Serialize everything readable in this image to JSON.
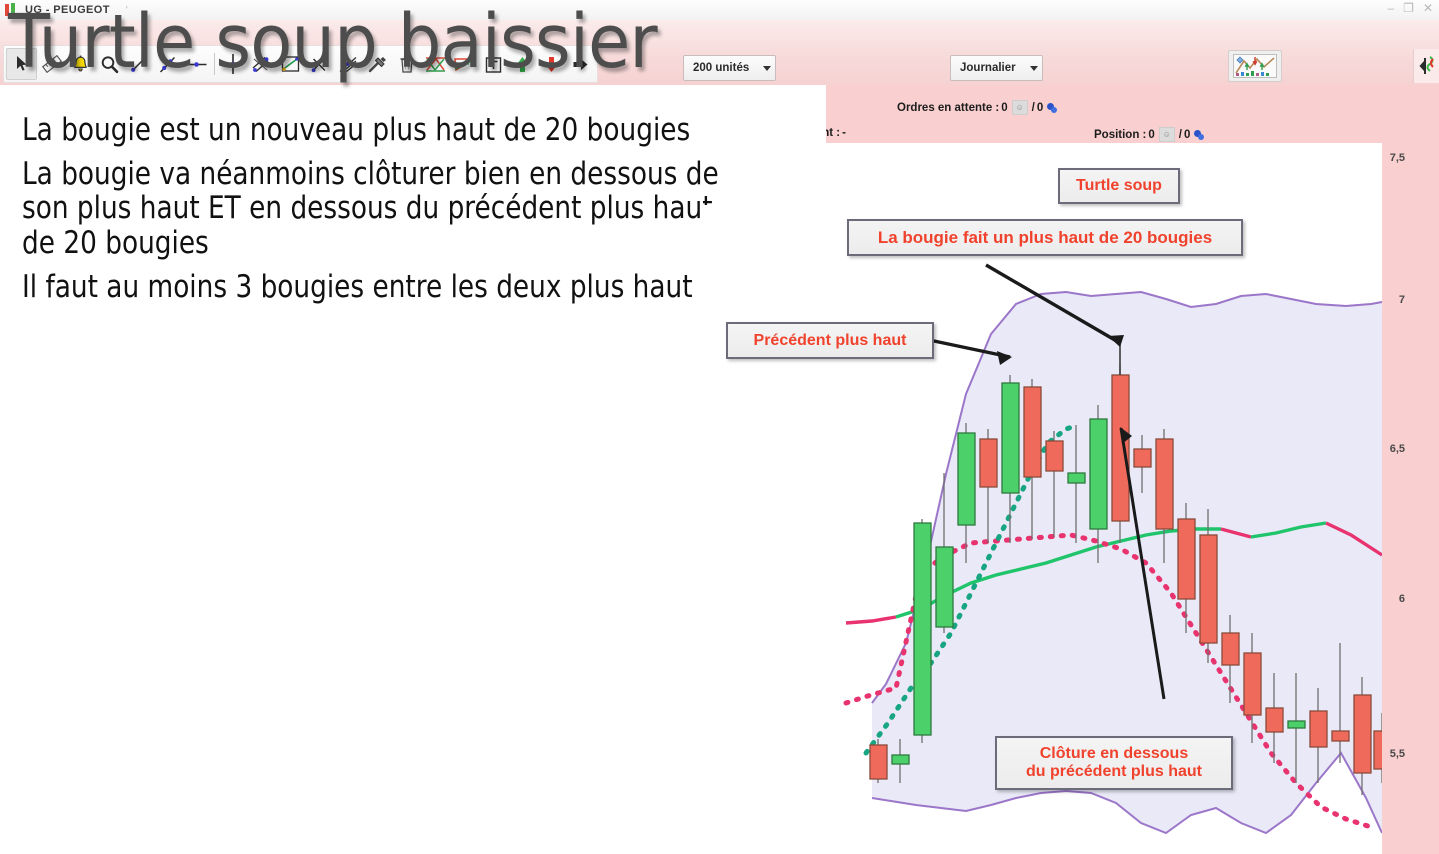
{
  "window": {
    "title": "UG - PEUGEOT",
    "tail_text": "'",
    "icon": "candlestick-icon",
    "controls": {
      "minimize": "–",
      "restore": "❐",
      "close": "✕"
    }
  },
  "toolbar": {
    "tools": [
      {
        "name": "cursor-tool",
        "label": "Curseur",
        "selected": true
      },
      {
        "name": "ruler-tool",
        "label": "Règle"
      },
      {
        "name": "alert-bell-tool",
        "label": "Alerte"
      },
      {
        "name": "zoom-tool",
        "label": "Zoom"
      },
      {
        "name": "short-line-tool",
        "label": "Segment court"
      },
      {
        "name": "line-tool",
        "label": "Droite"
      },
      {
        "name": "horizontal-line-tool",
        "label": "Ligne horizontale"
      },
      {
        "name": "vertical-line-tool",
        "label": "Ligne verticale"
      },
      {
        "name": "parallel-lines-tool",
        "label": "Lignes parallèles"
      },
      {
        "name": "channel-tool",
        "label": "Canal"
      },
      {
        "name": "cross-lines-tool",
        "label": "Croix"
      },
      {
        "name": "fan-lines-tool",
        "label": "Éventail"
      },
      {
        "name": "tools-hammer-tool",
        "label": "Outils"
      },
      {
        "name": "trash-tool",
        "label": "Supprimer"
      },
      {
        "name": "zigzag-indicator-tool",
        "label": "Zigzag"
      },
      {
        "name": "pattern-tool",
        "label": "Figure"
      },
      {
        "name": "text-tool",
        "label": "Texte"
      },
      {
        "name": "arrow-up-tool",
        "label": "Flèche haut"
      },
      {
        "name": "arrow-down-tool",
        "label": "Flèche bas"
      },
      {
        "name": "arrow-right-tool",
        "label": "Flèche droite"
      }
    ],
    "units_dropdown": {
      "value": "200 unités"
    },
    "timeframe_dropdown": {
      "value": "Journalier"
    },
    "analysis_button": {
      "name": "chart-analysis-button"
    },
    "panel_button": {
      "name": "side-panel-button"
    }
  },
  "info_bar": {
    "ordres_label": "Ordres en attente :",
    "ordres_pending": "0",
    "ordres_separator": "/",
    "ordres_open": "0",
    "montant_label": "ntant :",
    "montant_value": "-",
    "position_label": "Position :",
    "position_a": "0",
    "position_separator": "/",
    "position_b": "0"
  },
  "slide": {
    "title": "Turtle soup baissier",
    "bullets": [
      "La bougie est un nouveau plus haut de 20 bougies",
      "La bougie va néanmoins clôturer bien en dessous de son plus haut ET en dessous du précédent plus haut de 20 bougies",
      "Il faut au moins 3 bougies entre les deux plus haut"
    ]
  },
  "callouts": {
    "turtle_soup": "Turtle soup",
    "plus_haut": "La bougie fait un plus haut de 20 bougies",
    "precedent": "Précédent plus haut",
    "cloture": "Clôture en dessous\n du précédent plus haut"
  },
  "colors": {
    "toolbar_pink": "#f7d9d9",
    "info_pink": "#f9cfcf",
    "chart_bg": "#e9e9f7",
    "bollinger": "#9b76c9",
    "candle_up": "#4cd06a",
    "candle_up_border": "#2c7a3f",
    "candle_down": "#ef6a5a",
    "candle_down_border": "#8a4a3a",
    "ma_green": "#1fc46b",
    "ma_pink": "#e8336f",
    "ma_teal": "#17a582",
    "callout_text": "#f0422c",
    "callout_border": "#6b6b7a"
  },
  "chart_data": {
    "type": "candlestick",
    "title": "UG - PEUGEOT",
    "timeframe": "Journalier",
    "units": "200 unités",
    "ylabel": "",
    "xlabel": "",
    "ylim": [
      5.3,
      7.7
    ],
    "y_ticks": [
      "7,5",
      "7",
      "6,5",
      "6",
      "5,5"
    ],
    "y_tick_values": [
      7.5,
      7.0,
      6.5,
      6.0,
      5.5
    ],
    "grid": false,
    "candles": [
      {
        "i": 0,
        "open": 5.62,
        "high": 5.7,
        "low": 5.5,
        "close": 5.52,
        "dir": "down"
      },
      {
        "i": 1,
        "open": 5.57,
        "high": 5.66,
        "low": 5.5,
        "close": 5.58,
        "dir": "up"
      },
      {
        "i": 2,
        "open": 5.6,
        "high": 6.42,
        "low": 5.57,
        "close": 6.4,
        "dir": "up"
      },
      {
        "i": 3,
        "open": 6.1,
        "high": 6.58,
        "low": 6.05,
        "close": 6.38,
        "dir": "up"
      },
      {
        "i": 4,
        "open": 6.2,
        "high": 6.78,
        "low": 6.15,
        "close": 6.7,
        "dir": "up"
      },
      {
        "i": 5,
        "open": 6.62,
        "high": 6.72,
        "low": 6.4,
        "close": 6.56,
        "dir": "down"
      },
      {
        "i": 6,
        "open": 6.45,
        "high": 6.9,
        "low": 6.4,
        "close": 6.86,
        "dir": "up"
      },
      {
        "i": 7,
        "open": 6.82,
        "high": 6.88,
        "low": 6.46,
        "close": 6.55,
        "dir": "down"
      },
      {
        "i": 8,
        "open": 6.58,
        "high": 6.66,
        "low": 6.38,
        "close": 6.52,
        "dir": "down"
      },
      {
        "i": 9,
        "open": 6.52,
        "high": 6.62,
        "low": 6.32,
        "close": 6.55,
        "dir": "up"
      },
      {
        "i": 10,
        "open": 6.46,
        "high": 6.84,
        "low": 6.34,
        "close": 6.8,
        "dir": "up"
      },
      {
        "i": 11,
        "open": 6.92,
        "high": 6.98,
        "low": 6.52,
        "close": 6.58,
        "dir": "down"
      },
      {
        "i": 12,
        "open": 6.66,
        "high": 6.72,
        "low": 6.56,
        "close": 6.62,
        "dir": "down"
      },
      {
        "i": 13,
        "open": 6.68,
        "high": 6.74,
        "low": 6.3,
        "close": 6.36,
        "dir": "down"
      },
      {
        "i": 14,
        "open": 6.34,
        "high": 6.4,
        "low": 6.18,
        "close": 6.22,
        "dir": "down"
      },
      {
        "i": 15,
        "open": 6.28,
        "high": 6.36,
        "low": 5.92,
        "close": 5.98,
        "dir": "down"
      },
      {
        "i": 16,
        "open": 6.02,
        "high": 6.06,
        "low": 5.86,
        "close": 5.94,
        "dir": "down"
      },
      {
        "i": 17,
        "open": 5.96,
        "high": 6.02,
        "low": 5.7,
        "close": 5.78,
        "dir": "down"
      },
      {
        "i": 18,
        "open": 5.82,
        "high": 5.86,
        "low": 5.66,
        "close": 5.8,
        "dir": "down"
      },
      {
        "i": 19,
        "open": 5.84,
        "high": 5.88,
        "low": 5.6,
        "close": 5.72,
        "dir": "down"
      },
      {
        "i": 20,
        "open": 5.76,
        "high": 6.02,
        "low": 5.62,
        "close": 5.74,
        "dir": "down"
      },
      {
        "i": 21,
        "open": 5.8,
        "high": 5.86,
        "low": 5.56,
        "close": 5.62,
        "dir": "down"
      },
      {
        "i": 22,
        "open": 5.66,
        "high": 5.7,
        "low": 5.52,
        "close": 5.58,
        "dir": "down"
      }
    ],
    "series": [
      {
        "name": "Bollinger supérieure",
        "style": "solid",
        "color": "#9b76c9"
      },
      {
        "name": "Bollinger inférieure",
        "style": "solid",
        "color": "#9b76c9"
      },
      {
        "name": "Moyenne mobile",
        "style": "solid",
        "color": "#1fc46b"
      },
      {
        "name": "Indicateur rose",
        "style": "dashed",
        "color": "#e8336f"
      },
      {
        "name": "Indicateur turquoise",
        "style": "dashed",
        "color": "#17a582"
      }
    ],
    "annotations": [
      {
        "text": "Turtle soup",
        "target": "candle 11"
      },
      {
        "text": "La bougie fait un plus haut de 20 bougies",
        "target": "candle 11 high"
      },
      {
        "text": "Précédent plus haut",
        "target": "candle 6 high"
      },
      {
        "text": "Clôture en dessous du précédent plus haut",
        "target": "candle 11 close"
      }
    ]
  }
}
